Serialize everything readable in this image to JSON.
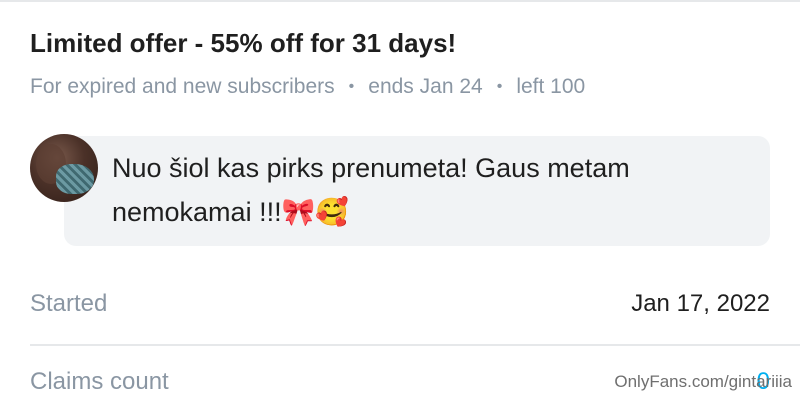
{
  "offer": {
    "title": "Limited offer - 55% off for 31 days!",
    "audience": "For expired and new subscribers",
    "separator": "•",
    "ends": "ends Jan 24",
    "left": "left 100"
  },
  "message": {
    "text": "Nuo šiol kas pirks prenumeta! Gaus metam nemokamai !!!🎀🥰"
  },
  "details": {
    "started_label": "Started",
    "started_value": "Jan 17, 2022",
    "claims_label": "Claims count",
    "claims_value": "0"
  },
  "watermark": "OnlyFans.com/gintariiia",
  "colors": {
    "muted": "#8a96a3",
    "accent": "#00aff0",
    "bubble": "#f1f3f5"
  }
}
